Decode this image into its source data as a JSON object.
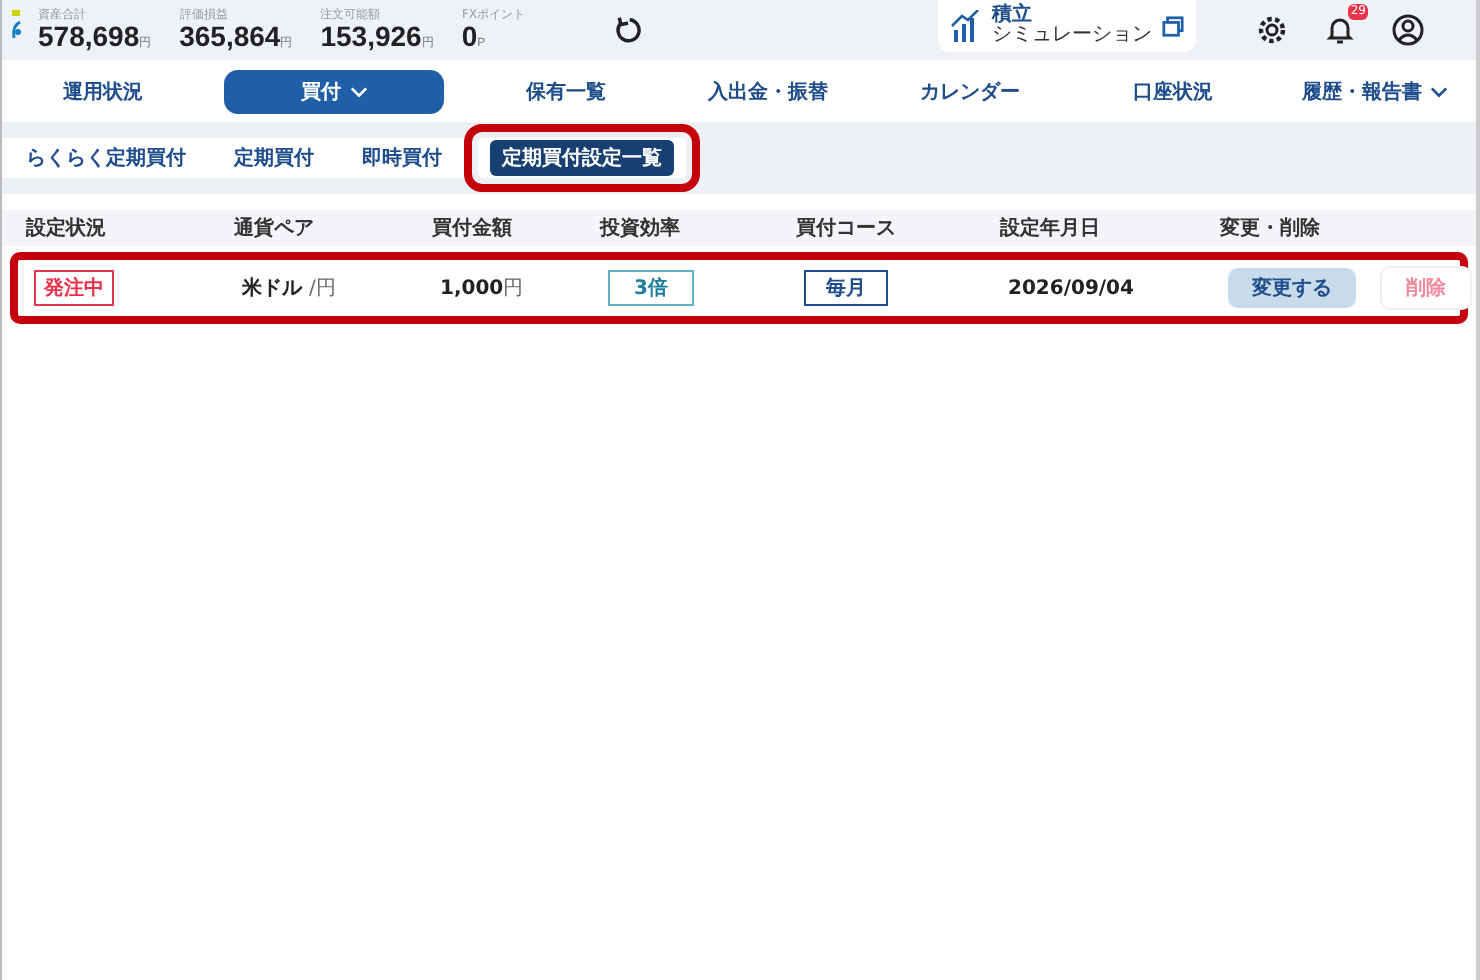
{
  "summary": {
    "items": [
      {
        "label": "資産合計",
        "value": "578,698",
        "unit": "円"
      },
      {
        "label": "評価損益",
        "value": "365,864",
        "unit": "円"
      },
      {
        "label": "注文可能額",
        "value": "153,926",
        "unit": "円"
      },
      {
        "label": "FXポイント",
        "value": "0",
        "unit": "P"
      }
    ]
  },
  "simulation": {
    "title": "積立",
    "subtitle": "シミュレーション"
  },
  "notifications": {
    "badge": "29"
  },
  "nav": {
    "tabs": [
      {
        "label": "運用状況",
        "selected": false,
        "dropdown": false
      },
      {
        "label": "買付",
        "selected": true,
        "dropdown": true
      },
      {
        "label": "保有一覧",
        "selected": false,
        "dropdown": false
      },
      {
        "label": "入出金・振替",
        "selected": false,
        "dropdown": false
      },
      {
        "label": "カレンダー",
        "selected": false,
        "dropdown": false
      },
      {
        "label": "口座状況",
        "selected": false,
        "dropdown": false
      },
      {
        "label": "履歴・報告書",
        "selected": false,
        "dropdown": true
      }
    ]
  },
  "subnav": {
    "tabs": [
      {
        "label": "らくらく定期買付",
        "selected": false,
        "highlighted": false
      },
      {
        "label": "定期買付",
        "selected": false,
        "highlighted": false
      },
      {
        "label": "即時買付",
        "selected": false,
        "highlighted": false
      },
      {
        "label": "定期買付設定一覧",
        "selected": true,
        "highlighted": true
      }
    ]
  },
  "table": {
    "columns": [
      "設定状況",
      "通貨ペア",
      "買付金額",
      "投資効率",
      "買付コース",
      "設定年月日",
      "変更・削除"
    ],
    "rows": [
      {
        "highlighted": true,
        "cells": [
          {
            "kind": "status",
            "text": "発注中"
          },
          {
            "kind": "pair",
            "text": "米ドル",
            "unit": "/円"
          },
          {
            "kind": "amount",
            "text": "1,000",
            "unit": "円"
          },
          {
            "kind": "ratio",
            "text": "3倍"
          },
          {
            "kind": "course",
            "text": "毎月"
          },
          {
            "kind": "plain",
            "text": "2026/09/04"
          },
          {
            "kind": "actions",
            "edit": "変更する",
            "delete": "削除"
          }
        ]
      }
    ]
  }
}
